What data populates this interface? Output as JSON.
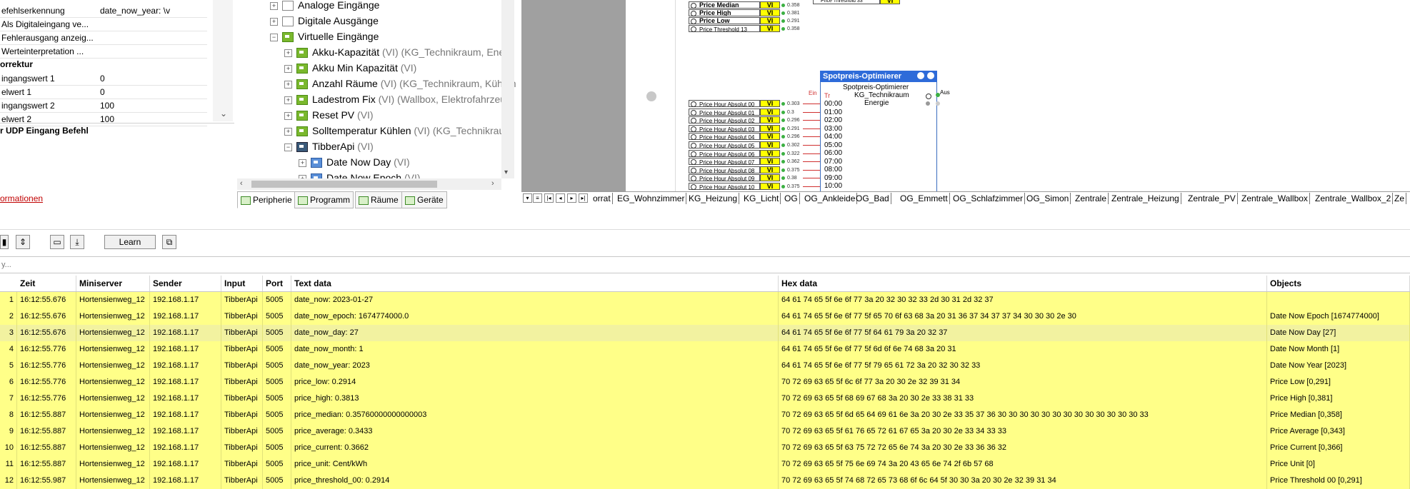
{
  "properties": {
    "rows_top": [
      {
        "key": "efehlserkennung",
        "value": "date_now_year: \\v"
      },
      {
        "key": "Als Digitaleingang ve...",
        "value": ""
      },
      {
        "key": "Fehlerausgang anzeig...",
        "value": ""
      },
      {
        "key": "Werteinterpretation ...",
        "value": ""
      }
    ],
    "section_korrektur": "orrektur",
    "rows_korrektur": [
      {
        "key": "ingangswert 1",
        "value": "0"
      },
      {
        "key": "elwert 1",
        "value": "0"
      },
      {
        "key": "ingangswert 2",
        "value": "100"
      },
      {
        "key": "elwert 2",
        "value": "100"
      }
    ],
    "description_title": "r UDP Eingang Befehl",
    "info_link": "ormationen"
  },
  "tree": {
    "items": [
      {
        "label": "Analoge Eingänge",
        "suffix": "",
        "icon": "analog-input-icon"
      },
      {
        "label": "Digitale Ausgänge",
        "suffix": "",
        "icon": "digital-output-icon"
      },
      {
        "label": "Virtuelle Eingänge",
        "suffix": "",
        "icon": "virtual-input-icon"
      },
      {
        "label": "Akku-Kapazität",
        "suffix": " (VI) (KG_Technikraum, Energ",
        "icon": "virtual-input-icon"
      },
      {
        "label": "Akku Min Kapazität",
        "suffix": " (VI)",
        "icon": "virtual-input-icon"
      },
      {
        "label": "Anzahl Räume",
        "suffix": " (VI) (KG_Technikraum, Kühlun",
        "icon": "virtual-input-icon"
      },
      {
        "label": "Ladestrom Fix",
        "suffix": " (VI) (Wallbox, Elektrofahrzeug)",
        "icon": "virtual-input-icon"
      },
      {
        "label": "Reset PV",
        "suffix": " (VI)",
        "icon": "virtual-input-icon"
      },
      {
        "label": "Solltemperatur Kühlen",
        "suffix": " (VI) (KG_Technikraum",
        "icon": "virtual-input-icon"
      },
      {
        "label": "TibberApi",
        "suffix": " (VI)",
        "icon": "udp-input-icon"
      },
      {
        "label": "Date Now Day",
        "suffix": " (VI)",
        "icon": "udp-command-icon"
      },
      {
        "label": "Date Now Epoch",
        "suffix": " (VI)",
        "icon": "udp-command-icon"
      }
    ],
    "bottom_tabs": [
      "Peripherie",
      "Programm",
      "Räume",
      "Geräte"
    ]
  },
  "canvas": {
    "top_blocks": [
      {
        "label": "Price Median",
        "value": "0.358"
      },
      {
        "label": "Price High",
        "value": "0.381"
      },
      {
        "label": "Price Low",
        "value": "0.291"
      },
      {
        "label": "Price Threshold 13",
        "value": "0.358"
      }
    ],
    "vi_text": "VI",
    "top_right_label": "Price Threshold 33",
    "hour_blocks": [
      {
        "label": "Price Hour Absolut 00",
        "value": "0.303"
      },
      {
        "label": "Price Hour Absolut 01",
        "value": "0.3"
      },
      {
        "label": "Price Hour Absolut 02",
        "value": "0.296"
      },
      {
        "label": "Price Hour Absolut 03",
        "value": "0.291"
      },
      {
        "label": "Price Hour Absolut 04",
        "value": "0.296"
      },
      {
        "label": "Price Hour Absolut 05",
        "value": "0.302"
      },
      {
        "label": "Price Hour Absolut 06",
        "value": "0.322"
      },
      {
        "label": "Price Hour Absolut 07",
        "value": "0.362"
      },
      {
        "label": "Price Hour Absolut 08",
        "value": "0.375"
      },
      {
        "label": "Price Hour Absolut 09",
        "value": "0.38"
      },
      {
        "label": "Price Hour Absolut 10",
        "value": "0.375"
      }
    ],
    "optimizer": {
      "title": "Spotpreis-Optimierer",
      "subtitle": "Spotpreis-Optimierer",
      "room": "KG_Technikraum",
      "category": "Energie",
      "in_label": "Ein",
      "tr_label": "Tr",
      "out_label": "Aus",
      "hours": [
        "00:00",
        "01:00",
        "02:00",
        "03:00",
        "04:00",
        "05:00",
        "06:00",
        "07:00",
        "08:00",
        "09:00",
        "10:00"
      ]
    },
    "page_tabs": [
      "orrat",
      "EG_Wohnzimmer",
      "KG_Heizung",
      "KG_Licht",
      "OG",
      "OG_Ankleide",
      "OG_Bad",
      "OG_Emmett",
      "OG_Schlafzimmer",
      "OG_Simon",
      "Zentrale",
      "Zentrale_Heizung",
      "Zentrale_PV",
      "Zentrale_Wallbox",
      "Zentrale_Wallbox_2",
      "Ze"
    ]
  },
  "toolbar": {
    "learn_label": "Learn",
    "filter_text": "y..."
  },
  "table": {
    "columns": [
      "Zeit",
      "Miniserver",
      "Sender",
      "Input",
      "Port",
      "Text data",
      "Hex data",
      "Objects"
    ],
    "rows": [
      {
        "n": "1",
        "zeit": "16:12:55.676",
        "miniserver": "Hortensienweg_12",
        "sender": "192.168.1.17",
        "input": "TibberApi",
        "port": "5005",
        "text": "date_now: 2023-01-27",
        "hex": "64 61 74 65 5f 6e 6f 77 3a 20 32 30 32 33 2d 30 31 2d 32 37",
        "objects": ""
      },
      {
        "n": "2",
        "zeit": "16:12:55.676",
        "miniserver": "Hortensienweg_12",
        "sender": "192.168.1.17",
        "input": "TibberApi",
        "port": "5005",
        "text": "date_now_epoch: 1674774000.0",
        "hex": "64 61 74 65 5f 6e 6f 77 5f 65 70 6f 63 68 3a 20 31 36 37 34 37 37 34 30 30 30 2e 30",
        "objects": "Date Now Epoch [1674774000]"
      },
      {
        "n": "3",
        "zeit": "16:12:55.676",
        "miniserver": "Hortensienweg_12",
        "sender": "192.168.1.17",
        "input": "TibberApi",
        "port": "5005",
        "text": "date_now_day: 27",
        "hex": "64 61 74 65 5f 6e 6f 77 5f 64 61 79 3a 20 32 37",
        "objects": "Date Now Day [27]"
      },
      {
        "n": "4",
        "zeit": "16:12:55.776",
        "miniserver": "Hortensienweg_12",
        "sender": "192.168.1.17",
        "input": "TibberApi",
        "port": "5005",
        "text": "date_now_month: 1",
        "hex": "64 61 74 65 5f 6e 6f 77 5f 6d 6f 6e 74 68 3a 20 31",
        "objects": "Date Now Month [1]"
      },
      {
        "n": "5",
        "zeit": "16:12:55.776",
        "miniserver": "Hortensienweg_12",
        "sender": "192.168.1.17",
        "input": "TibberApi",
        "port": "5005",
        "text": "date_now_year: 2023",
        "hex": "64 61 74 65 5f 6e 6f 77 5f 79 65 61 72 3a 20 32 30 32 33",
        "objects": "Date Now Year [2023]"
      },
      {
        "n": "6",
        "zeit": "16:12:55.776",
        "miniserver": "Hortensienweg_12",
        "sender": "192.168.1.17",
        "input": "TibberApi",
        "port": "5005",
        "text": "price_low: 0.2914",
        "hex": "70 72 69 63 65 5f 6c 6f 77 3a 20 30 2e 32 39 31 34",
        "objects": "Price Low [0,291]"
      },
      {
        "n": "7",
        "zeit": "16:12:55.776",
        "miniserver": "Hortensienweg_12",
        "sender": "192.168.1.17",
        "input": "TibberApi",
        "port": "5005",
        "text": "price_high: 0.3813",
        "hex": "70 72 69 63 65 5f 68 69 67 68 3a 20 30 2e 33 38 31 33",
        "objects": "Price High [0,381]"
      },
      {
        "n": "8",
        "zeit": "16:12:55.887",
        "miniserver": "Hortensienweg_12",
        "sender": "192.168.1.17",
        "input": "TibberApi",
        "port": "5005",
        "text": "price_median: 0.35760000000000003",
        "hex": "70 72 69 63 65 5f 6d 65 64 69 61 6e 3a 20 30 2e 33 35 37 36 30 30 30 30 30 30 30 30 30 30 30 30 30 33",
        "objects": "Price Median [0,358]"
      },
      {
        "n": "9",
        "zeit": "16:12:55.887",
        "miniserver": "Hortensienweg_12",
        "sender": "192.168.1.17",
        "input": "TibberApi",
        "port": "5005",
        "text": "price_average: 0.3433",
        "hex": "70 72 69 63 65 5f 61 76 65 72 61 67 65 3a 20 30 2e 33 34 33 33",
        "objects": "Price Average [0,343]"
      },
      {
        "n": "10",
        "zeit": "16:12:55.887",
        "miniserver": "Hortensienweg_12",
        "sender": "192.168.1.17",
        "input": "TibberApi",
        "port": "5005",
        "text": "price_current: 0.3662",
        "hex": "70 72 69 63 65 5f 63 75 72 72 65 6e 74 3a 20 30 2e 33 36 36 32",
        "objects": "Price Current [0,366]"
      },
      {
        "n": "11",
        "zeit": "16:12:55.887",
        "miniserver": "Hortensienweg_12",
        "sender": "192.168.1.17",
        "input": "TibberApi",
        "port": "5005",
        "text": "price_unit: Cent/kWh",
        "hex": "70 72 69 63 65 5f 75 6e 69 74 3a 20 43 65 6e 74 2f 6b 57 68",
        "objects": "Price Unit [0]"
      },
      {
        "n": "12",
        "zeit": "16:12:55.987",
        "miniserver": "Hortensienweg_12",
        "sender": "192.168.1.17",
        "input": "TibberApi",
        "port": "5005",
        "text": "price_threshold_00: 0.2914",
        "hex": "70 72 69 63 65 5f 74 68 72 65 73 68 6f 6c 64 5f 30 30 3a 20 30 2e 32 39 31 34",
        "objects": "Price Threshold 00 [0,291]"
      }
    ]
  },
  "colors": {
    "row_yellow": "#ffff88",
    "row_selected": "#f2f2a0",
    "block_header_blue": "#2e6bd9",
    "vi_yellow": "#ffff00",
    "tree_icon_green": "#7ab82d",
    "link_red": "#c00000"
  }
}
